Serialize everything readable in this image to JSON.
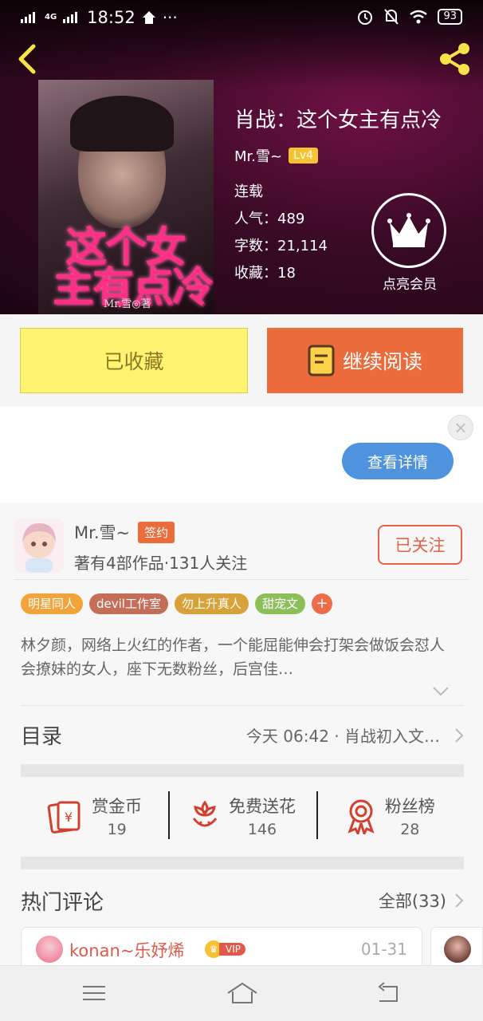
{
  "status_bar": {
    "network": "4G",
    "network2": "G",
    "time": "18:52",
    "battery": "93"
  },
  "book": {
    "title": "肖战：这个女主有点冷",
    "author": "Mr.雪~",
    "author_level": "Lv4",
    "status": "连载",
    "popularity_label": "人气：",
    "popularity": "489",
    "word_count_label": "字数：",
    "word_count": "21,114",
    "favorites_label": "收藏：",
    "favorites": "18",
    "cover_title_line1": "这个女",
    "cover_title_line2": "主有点冷",
    "cover_author": "Mr.雪◎著",
    "member_label": "点亮会员"
  },
  "actions": {
    "saved": "已收藏",
    "continue_reading": "继续阅读"
  },
  "ad": {
    "details_button": "查看详情",
    "close": "×"
  },
  "author_card": {
    "name": "Mr.雪~",
    "badge": "签约",
    "summary": "著有4部作品·131人关注",
    "follow_button": "已关注"
  },
  "tags": [
    {
      "label": "明星同人",
      "color": "#f2a43a"
    },
    {
      "label": "devil工作室",
      "color": "#c46e5a"
    },
    {
      "label": "勿上升真人",
      "color": "#d8a23a"
    },
    {
      "label": "甜宠文",
      "color": "#8cbf5a"
    }
  ],
  "tag_more": "+",
  "description": "林夕颜，网络上火红的作者，一个能屈能伸会打架会做饭会怼人会撩妹的女人，座下无数粉丝，后宫佳…",
  "toc": {
    "title": "目录",
    "latest": "今天 06:42 · 肖战初入文…"
  },
  "stats": [
    {
      "label": "赏金币",
      "value": "19",
      "icon": "coin-envelope-icon"
    },
    {
      "label": "免费送花",
      "value": "146",
      "icon": "flower-icon"
    },
    {
      "label": "粉丝榜",
      "value": "28",
      "icon": "medal-icon"
    }
  ],
  "comments": {
    "title": "热门评论",
    "all_label": "全部(33)",
    "first": {
      "user": "konan~乐妤烯",
      "vip": "VIP",
      "date": "01-31"
    }
  },
  "colors": {
    "accent": "#ec6b3a",
    "saved_bg": "#fff36f",
    "ad_button": "#4f92de",
    "hero": "#3a0a26"
  }
}
